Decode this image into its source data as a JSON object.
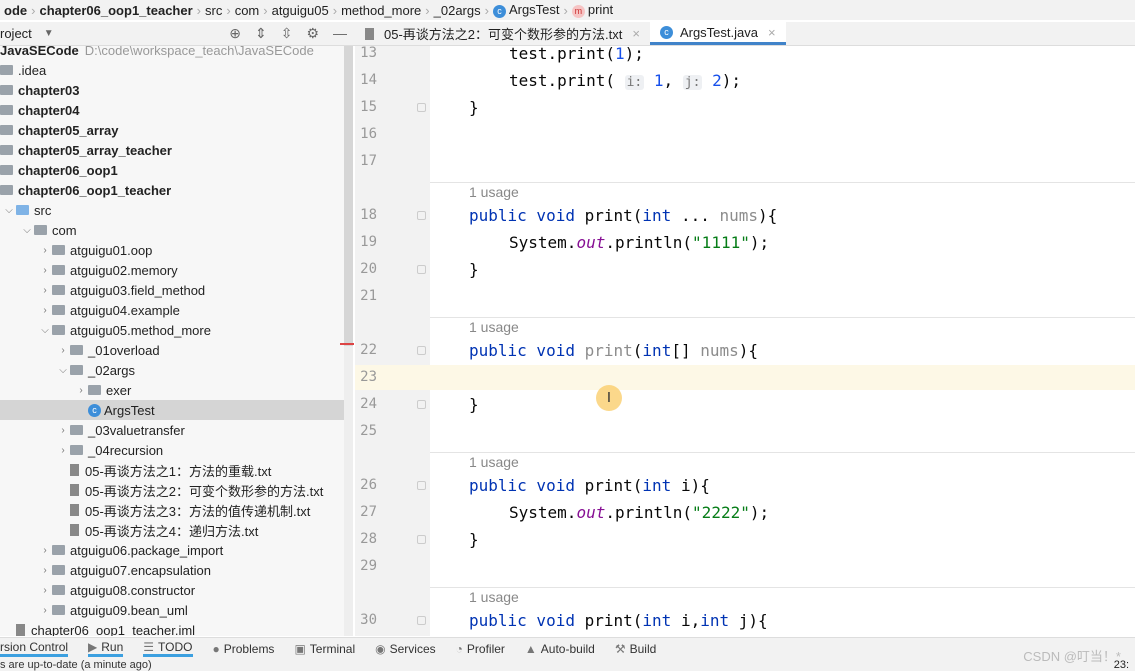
{
  "breadcrumb": [
    "ode",
    "chapter06_oop1_teacher",
    "src",
    "com",
    "atguigu05",
    "method_more",
    "_02args",
    "ArgsTest",
    "print"
  ],
  "project": {
    "label": "roject",
    "root": "JavaSECode",
    "root_path": "D:\\code\\workspace_teach\\JavaSECode"
  },
  "tabs": [
    {
      "label": "05-再谈方法之2：可变个数形参的方法.txt",
      "active": false
    },
    {
      "label": "ArgsTest.java",
      "active": true
    }
  ],
  "tree": [
    {
      "label": ".idea",
      "depth": 0,
      "type": "folder",
      "bold": false
    },
    {
      "label": "chapter03",
      "depth": 0,
      "type": "folder",
      "bold": true
    },
    {
      "label": "chapter04",
      "depth": 0,
      "type": "folder",
      "bold": true
    },
    {
      "label": "chapter05_array",
      "depth": 0,
      "type": "folder",
      "bold": true
    },
    {
      "label": "chapter05_array_teacher",
      "depth": 0,
      "type": "folder",
      "bold": true
    },
    {
      "label": "chapter06_oop1",
      "depth": 0,
      "type": "folder",
      "bold": true
    },
    {
      "label": "chapter06_oop1_teacher",
      "depth": 0,
      "type": "folder",
      "bold": true
    },
    {
      "label": "src",
      "depth": 1,
      "type": "srcfolder",
      "arrow": "open"
    },
    {
      "label": "com",
      "depth": 2,
      "type": "folder",
      "arrow": "open"
    },
    {
      "label": "atguigu01.oop",
      "depth": 3,
      "type": "folder",
      "arrow": "closed"
    },
    {
      "label": "atguigu02.memory",
      "depth": 3,
      "type": "folder",
      "arrow": "closed"
    },
    {
      "label": "atguigu03.field_method",
      "depth": 3,
      "type": "folder",
      "arrow": "closed"
    },
    {
      "label": "atguigu04.example",
      "depth": 3,
      "type": "folder",
      "arrow": "closed"
    },
    {
      "label": "atguigu05.method_more",
      "depth": 3,
      "type": "folder",
      "arrow": "open"
    },
    {
      "label": "_01overload",
      "depth": 4,
      "type": "folder",
      "arrow": "closed"
    },
    {
      "label": "_02args",
      "depth": 4,
      "type": "folder",
      "arrow": "open"
    },
    {
      "label": "exer",
      "depth": 5,
      "type": "folder",
      "arrow": "closed"
    },
    {
      "label": "ArgsTest",
      "depth": 5,
      "type": "class",
      "selected": true
    },
    {
      "label": "_03valuetransfer",
      "depth": 4,
      "type": "folder",
      "arrow": "closed"
    },
    {
      "label": "_04recursion",
      "depth": 4,
      "type": "folder",
      "arrow": "closed"
    },
    {
      "label": "05-再谈方法之1：方法的重载.txt",
      "depth": 4,
      "type": "file"
    },
    {
      "label": "05-再谈方法之2：可变个数形参的方法.txt",
      "depth": 4,
      "type": "file"
    },
    {
      "label": "05-再谈方法之3：方法的值传递机制.txt",
      "depth": 4,
      "type": "file"
    },
    {
      "label": "05-再谈方法之4：递归方法.txt",
      "depth": 4,
      "type": "file"
    },
    {
      "label": "atguigu06.package_import",
      "depth": 3,
      "type": "folder",
      "arrow": "closed"
    },
    {
      "label": "atguigu07.encapsulation",
      "depth": 3,
      "type": "folder",
      "arrow": "closed"
    },
    {
      "label": "atguigu08.constructor",
      "depth": 3,
      "type": "folder",
      "arrow": "closed"
    },
    {
      "label": "atguigu09.bean_uml",
      "depth": 3,
      "type": "folder",
      "arrow": "closed"
    },
    {
      "label": "chapter06_oop1_teacher.iml",
      "depth": 1,
      "type": "file"
    }
  ],
  "editor": {
    "usage_label": "1 usage",
    "rows": [
      {
        "n": "13",
        "html": "    test.print(<span class=num>1</span>);"
      },
      {
        "n": "14",
        "html": "    test.print( <span class=hint>i:</span> <span class=num>1</span>, <span class=hint>j:</span> <span class=num>2</span>);"
      },
      {
        "n": "15",
        "html": "}",
        "fold": true
      },
      {
        "n": "16",
        "html": ""
      },
      {
        "n": "17",
        "html": ""
      },
      {
        "usage": true
      },
      {
        "n": "18",
        "html": "<span class=kw>public void</span> print(<span class=kw>int</span> ... <span class=gr>nums</span>){",
        "fold": true
      },
      {
        "n": "19",
        "html": "    System.<span class=it>out</span>.println(<span class=st>\"1111\"</span>);"
      },
      {
        "n": "20",
        "html": "}",
        "fold": true
      },
      {
        "n": "21",
        "html": ""
      },
      {
        "usage": true
      },
      {
        "n": "22",
        "html": "<span class=kw>public void</span> <span class=gr>print</span>(<span class=kw>int</span>[] <span class=gr>nums</span>){",
        "fold": true
      },
      {
        "n": "23",
        "html": "",
        "current": true
      },
      {
        "n": "24",
        "html": "}",
        "fold": true
      },
      {
        "n": "25",
        "html": ""
      },
      {
        "usage": true
      },
      {
        "n": "26",
        "html": "<span class=kw>public void</span> print(<span class=kw>int</span> i){",
        "fold": true
      },
      {
        "n": "27",
        "html": "    System.<span class=it>out</span>.println(<span class=st>\"2222\"</span>);"
      },
      {
        "n": "28",
        "html": "}",
        "fold": true
      },
      {
        "n": "29",
        "html": ""
      },
      {
        "usage": true
      },
      {
        "n": "30",
        "html": "<span class=kw>public void</span> print(<span class=kw>int</span> i,<span class=kw>int</span> j){",
        "fold": true
      }
    ]
  },
  "bottom_tools": [
    "rsion Control",
    "Run",
    "TODO",
    "Problems",
    "Terminal",
    "Services",
    "Profiler",
    "Auto-build",
    "Build"
  ],
  "bottom_icons": [
    "",
    "play-icon",
    "list-icon",
    "problems-icon",
    "terminal-icon",
    "services-icon",
    "profiler-icon",
    "auto-build-icon",
    "hammer-icon"
  ],
  "status": "s are up-to-date (a minute ago)",
  "watermark": "CSDN @叮当！*",
  "clock": "23:"
}
